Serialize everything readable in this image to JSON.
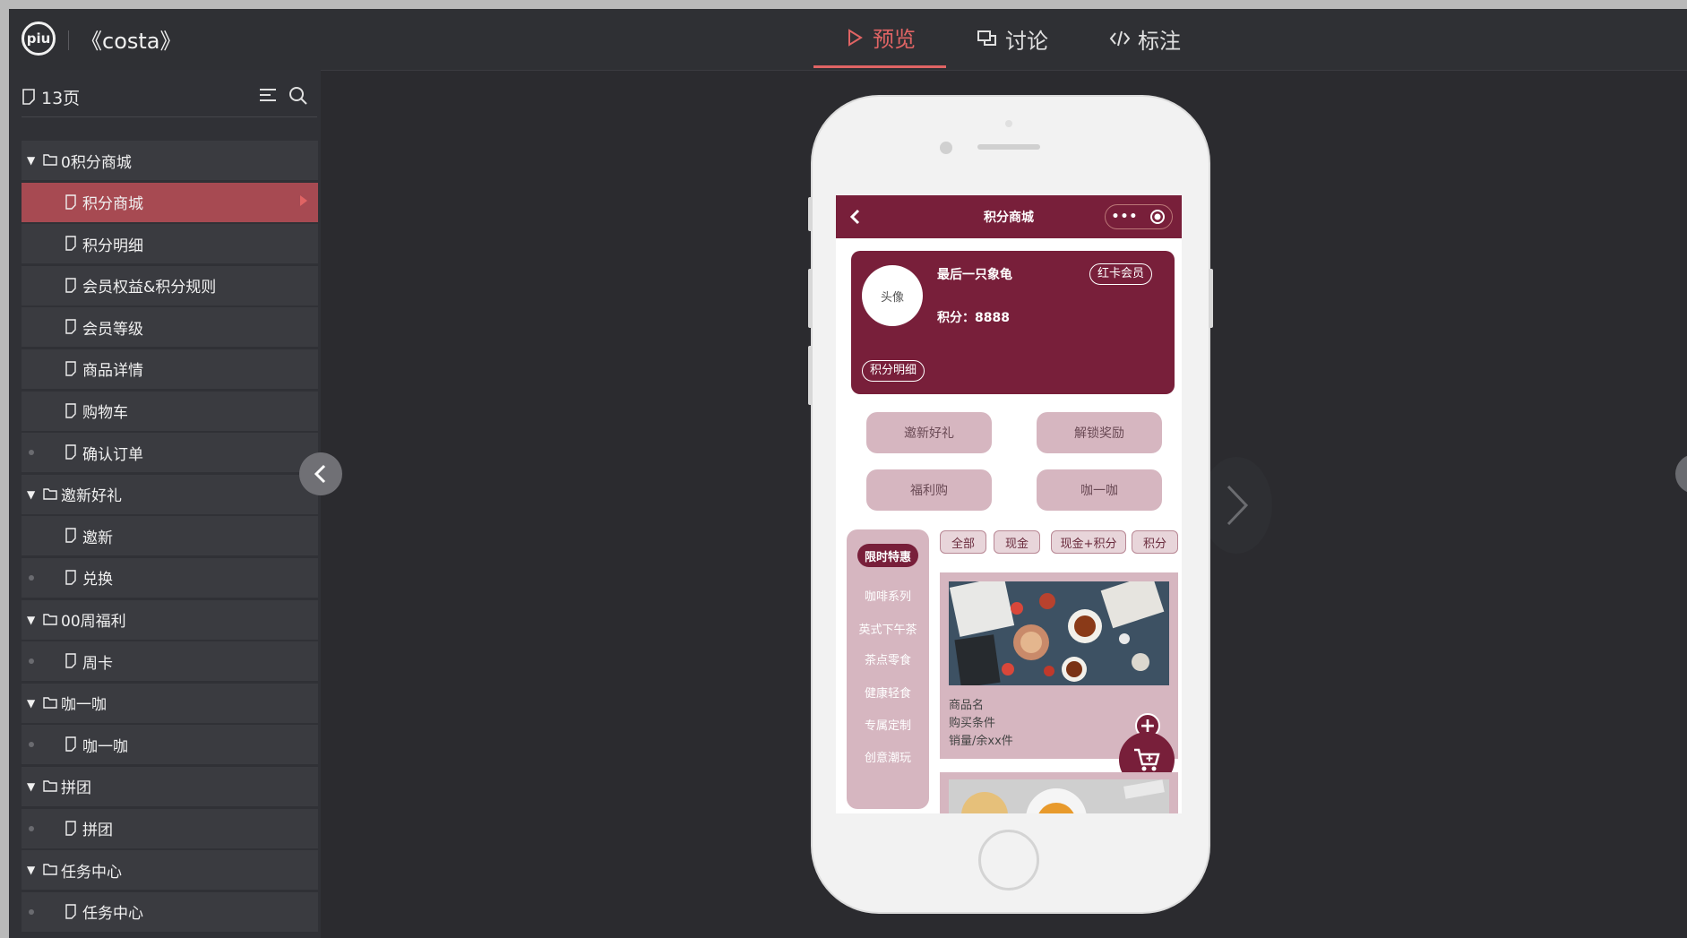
{
  "app": {
    "logo_text": "piu",
    "project_name": "《costa》",
    "tabs": [
      {
        "label": "预览",
        "icon": "play-icon",
        "active": true
      },
      {
        "label": "讨论",
        "icon": "chat-icon",
        "active": false
      },
      {
        "label": "标注",
        "icon": "code-icon",
        "active": false
      }
    ],
    "accent_color": "#e06464"
  },
  "sidebar": {
    "page_count": "13页",
    "tree": [
      {
        "type": "folder",
        "label": "0积分商城",
        "expanded": true
      },
      {
        "type": "page",
        "label": "积分商城",
        "selected": true
      },
      {
        "type": "page",
        "label": "积分明细"
      },
      {
        "type": "page",
        "label": "会员权益&积分规则"
      },
      {
        "type": "page",
        "label": "会员等级"
      },
      {
        "type": "page",
        "label": "商品详情"
      },
      {
        "type": "page",
        "label": "购物车"
      },
      {
        "type": "page",
        "label": "确认订单",
        "dot": true
      },
      {
        "type": "folder",
        "label": "邀新好礼",
        "expanded": true
      },
      {
        "type": "page",
        "label": "邀新"
      },
      {
        "type": "page",
        "label": "兑换",
        "dot": true
      },
      {
        "type": "folder",
        "label": "00周福利",
        "expanded": true
      },
      {
        "type": "page",
        "label": "周卡",
        "dot": true
      },
      {
        "type": "folder",
        "label": "咖一咖",
        "expanded": true
      },
      {
        "type": "page",
        "label": "咖一咖",
        "dot": true
      },
      {
        "type": "folder",
        "label": "拼团",
        "expanded": true
      },
      {
        "type": "page",
        "label": "拼团",
        "dot": true
      },
      {
        "type": "folder",
        "label": "任务中心",
        "expanded": true
      },
      {
        "type": "page",
        "label": "任务中心",
        "dot": true
      }
    ]
  },
  "phone": {
    "header_title": "积分商城",
    "header_color": "#781f3a",
    "user": {
      "avatar_label": "头像",
      "name": "最后一只象龟",
      "points": "积分：8888",
      "vip_badge": "红卡会员",
      "detail_link": "积分明细"
    },
    "feature_buttons": [
      "邀新好礼",
      "解锁奖励",
      "福利购",
      "咖一咖"
    ],
    "categories": {
      "active": "限时特惠",
      "items": [
        "咖啡系列",
        "英式下午茶",
        "茶点零食",
        "健康轻食",
        "专属定制",
        "创意潮玩"
      ]
    },
    "filters": [
      "全部",
      "现金",
      "现金+积分",
      "积分"
    ],
    "product": {
      "name": "商品名",
      "condition": "购买条件",
      "sales": "销量/余xx件"
    }
  }
}
